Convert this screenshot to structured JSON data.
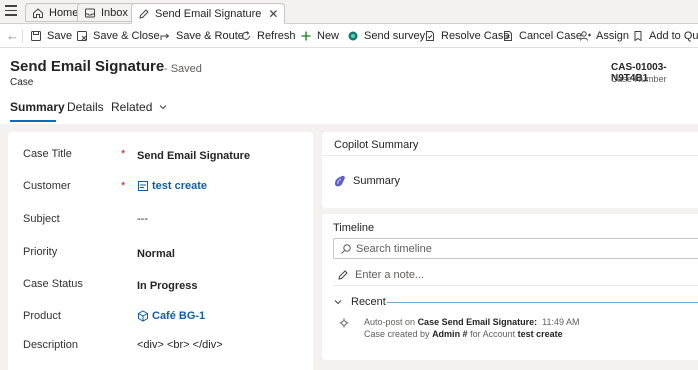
{
  "tabs": [
    {
      "label": "Home",
      "icon": "home-icon"
    },
    {
      "label": "Inbox",
      "icon": "inbox-icon"
    },
    {
      "label": "Send Email Signature",
      "icon": "pencil-icon",
      "active": true
    }
  ],
  "commands": {
    "save": "Save",
    "save_close": "Save & Close",
    "save_route": "Save & Route",
    "refresh": "Refresh",
    "new": "New",
    "send_survey": "Send survey",
    "resolve_case": "Resolve Case",
    "cancel_case": "Cancel Case",
    "assign": "Assign",
    "add_to_queue": "Add to Queu"
  },
  "header": {
    "title": "Send Email Signature",
    "status": "- Saved",
    "entity": "Case",
    "case_number": "CAS-01003-N9T4B1",
    "case_number_label": "Case Number"
  },
  "form_tabs": [
    "Summary",
    "Details",
    "Related"
  ],
  "fields": [
    {
      "label": "Case Title",
      "required": true,
      "value": "Send Email Signature",
      "style": "bold"
    },
    {
      "label": "Customer",
      "required": true,
      "value": "test create",
      "style": "link",
      "icon": "account-icon"
    },
    {
      "label": "Subject",
      "required": false,
      "value": "---",
      "style": "plain"
    },
    {
      "label": "Priority",
      "required": false,
      "value": "Normal",
      "style": "bold"
    },
    {
      "label": "Case Status",
      "required": false,
      "value": "In Progress",
      "style": "bold"
    },
    {
      "label": "Product",
      "required": false,
      "value": "Café BG-1",
      "style": "link",
      "icon": "product-icon"
    },
    {
      "label": "Description",
      "required": false,
      "value": "<div> <br> </div>",
      "style": "plain"
    }
  ],
  "copilot": {
    "title": "Copilot Summary",
    "summary_label": "Summary"
  },
  "timeline": {
    "title": "Timeline",
    "search_placeholder": "Search timeline",
    "note_placeholder": "Enter a note...",
    "recent_label": "Recent",
    "post": {
      "prefix": "Auto-post on",
      "subject": "Case Send Email Signature:",
      "time": "11:49 AM",
      "line2_prefix": "Case created by",
      "creator": "Admin #",
      "line2_mid": "for Account",
      "account": "test create"
    }
  },
  "colors": {
    "accent": "#0f6cbd",
    "link": "#115ea3",
    "required": "#c50f1f"
  }
}
